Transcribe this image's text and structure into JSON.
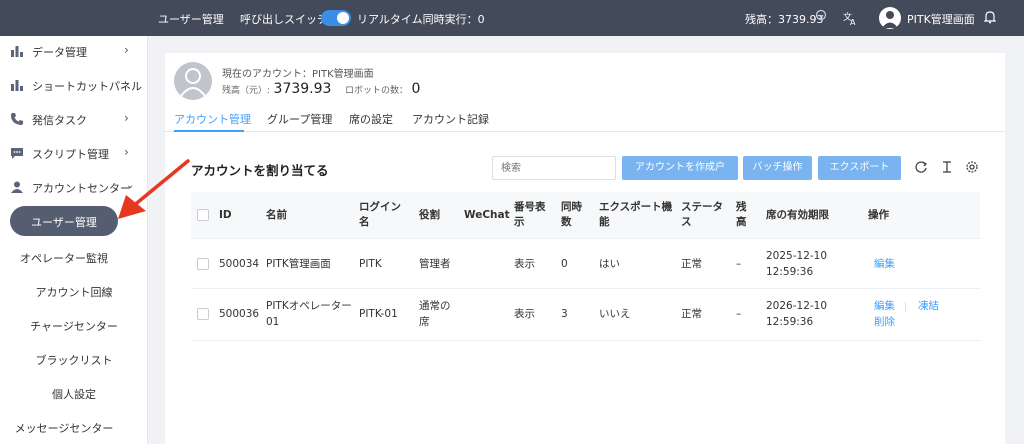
{
  "topbar": {
    "user_mgmt": "ユーザー管理",
    "call_switch": "呼び出しスイッチ",
    "realtime": "リアルタイム同時実行：0",
    "balance": "残高：3739.93",
    "username": "PITK管理画面",
    "icons": [
      "refresh-icon",
      "translate-icon",
      "user-avatar-icon",
      "bell-icon"
    ]
  },
  "sidebar": {
    "items": [
      {
        "label": "データ管理",
        "icon": "bar-chart-icon"
      },
      {
        "label": "ショートカットパネル",
        "icon": "bar-chart-icon"
      },
      {
        "label": "発信タスク",
        "icon": "phone-icon"
      },
      {
        "label": "スクリプト管理",
        "icon": "chat-icon"
      },
      {
        "label": "アカウントセンター",
        "icon": "user-icon"
      }
    ],
    "sub_items": [
      "ユーザー管理",
      "オペレーター監視",
      "アカウント回線",
      "チャージセンター",
      "ブラックリスト",
      "個人設定",
      "メッセージセンター"
    ]
  },
  "profile": {
    "current_account": "現在のアカウント：PITK管理画面",
    "balance_label": "残高（元）:",
    "balance_value": "3739.93",
    "robots_label": "ロボットの数：",
    "robots_value": "0"
  },
  "tabs": [
    "アカウント管理",
    "グループ管理",
    "席の設定",
    "アカウント記録"
  ],
  "toolbar": {
    "title": "アカウントを割り当てる",
    "search_placeholder": "検索",
    "create": "アカウントを作成户",
    "batch": "バッチ操作",
    "export": "エクスポート",
    "icons": [
      "refresh-icon",
      "column-height-icon",
      "settings-icon"
    ]
  },
  "table": {
    "headers": [
      "ID",
      "名前",
      "ログイン名",
      "役割",
      "WeChat",
      "番号表示",
      "同時数",
      "エクスポート機能",
      "ステータス",
      "残高",
      "席の有効期限",
      "操作"
    ],
    "rows": [
      {
        "id": "500034",
        "name": "PITK管理画面",
        "login": "PITK",
        "role": "管理者",
        "wechat": "",
        "display": "表示",
        "concurrent": "0",
        "export": "はい",
        "status": "正常",
        "balance": "–",
        "expiry_date": "2025-12-10",
        "expiry_time": "12:59:36",
        "actions": [
          "編集"
        ]
      },
      {
        "id": "500036",
        "name": "PITKオペレーター01",
        "login": "PITK-01",
        "role": "通常の席",
        "wechat": "",
        "display": "表示",
        "concurrent": "3",
        "export": "いいえ",
        "status": "正常",
        "balance": "–",
        "expiry_date": "2026-12-10",
        "expiry_time": "12:59:36",
        "actions": [
          "編集",
          "凍結",
          "削除"
        ]
      }
    ]
  },
  "colors": {
    "topbar": "#434a59",
    "accent": "#409eff",
    "button": "#79b4f0",
    "active_sidebar": "#555d70",
    "annotation_arrow": "#e8371f"
  }
}
